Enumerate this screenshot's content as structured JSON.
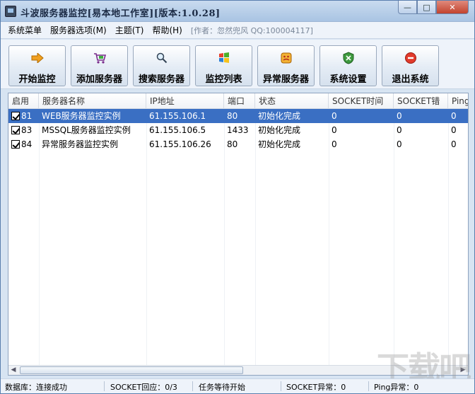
{
  "window": {
    "title": "斗波服务器监控[易本地工作室][版本:1.0.28]",
    "controls": {
      "minimize": "—",
      "maximize": "□",
      "close": "✕"
    }
  },
  "menu": {
    "items": [
      "系统菜单",
      "服务器选项(M)",
      "主题(T)",
      "帮助(H)"
    ],
    "author": "[作者：忽然兜风 QQ:100004117]"
  },
  "toolbar": {
    "buttons": [
      {
        "label": "开始监控",
        "icon": "arrow-right-icon"
      },
      {
        "label": "添加服务器",
        "icon": "cart-add-icon"
      },
      {
        "label": "搜索服务器",
        "icon": "magnifier-icon"
      },
      {
        "label": "监控列表",
        "icon": "windows-logo-icon"
      },
      {
        "label": "异常服务器",
        "icon": "warning-face-icon"
      },
      {
        "label": "系统设置",
        "icon": "shield-settings-icon"
      },
      {
        "label": "退出系统",
        "icon": "stop-icon"
      }
    ]
  },
  "table": {
    "columns": [
      "启用",
      "服务器名称",
      "IP地址",
      "端口",
      "状态",
      "SOCKET时间",
      "SOCKET错",
      "Ping"
    ],
    "rows": [
      {
        "id": "81",
        "name": "WEB服务器监控实例",
        "ip": "61.155.106.1",
        "port": "80",
        "status": "初始化完成",
        "socket_time": "0",
        "socket_err": "0",
        "ping": "0",
        "checked": true,
        "selected": true
      },
      {
        "id": "83",
        "name": "MSSQL服务器监控实例",
        "ip": "61.155.106.5",
        "port": "1433",
        "status": "初始化完成",
        "socket_time": "0",
        "socket_err": "0",
        "ping": "0",
        "checked": true,
        "selected": false
      },
      {
        "id": "84",
        "name": "异常服务器监控实例",
        "ip": "61.155.106.26",
        "port": "80",
        "status": "初始化完成",
        "socket_time": "0",
        "socket_err": "0",
        "ping": "0",
        "checked": true,
        "selected": false
      }
    ]
  },
  "status": {
    "db": "数据库：连接成功",
    "socket_reply": "SOCKET回应：0/3",
    "task": "任务等待开始",
    "socket_abnormal": "SOCKET异常：0",
    "ping_abnormal": "Ping异常：0"
  },
  "watermark": "下载吧",
  "colors": {
    "selection": "#3a6fc3",
    "accent": "#5a7fae"
  }
}
